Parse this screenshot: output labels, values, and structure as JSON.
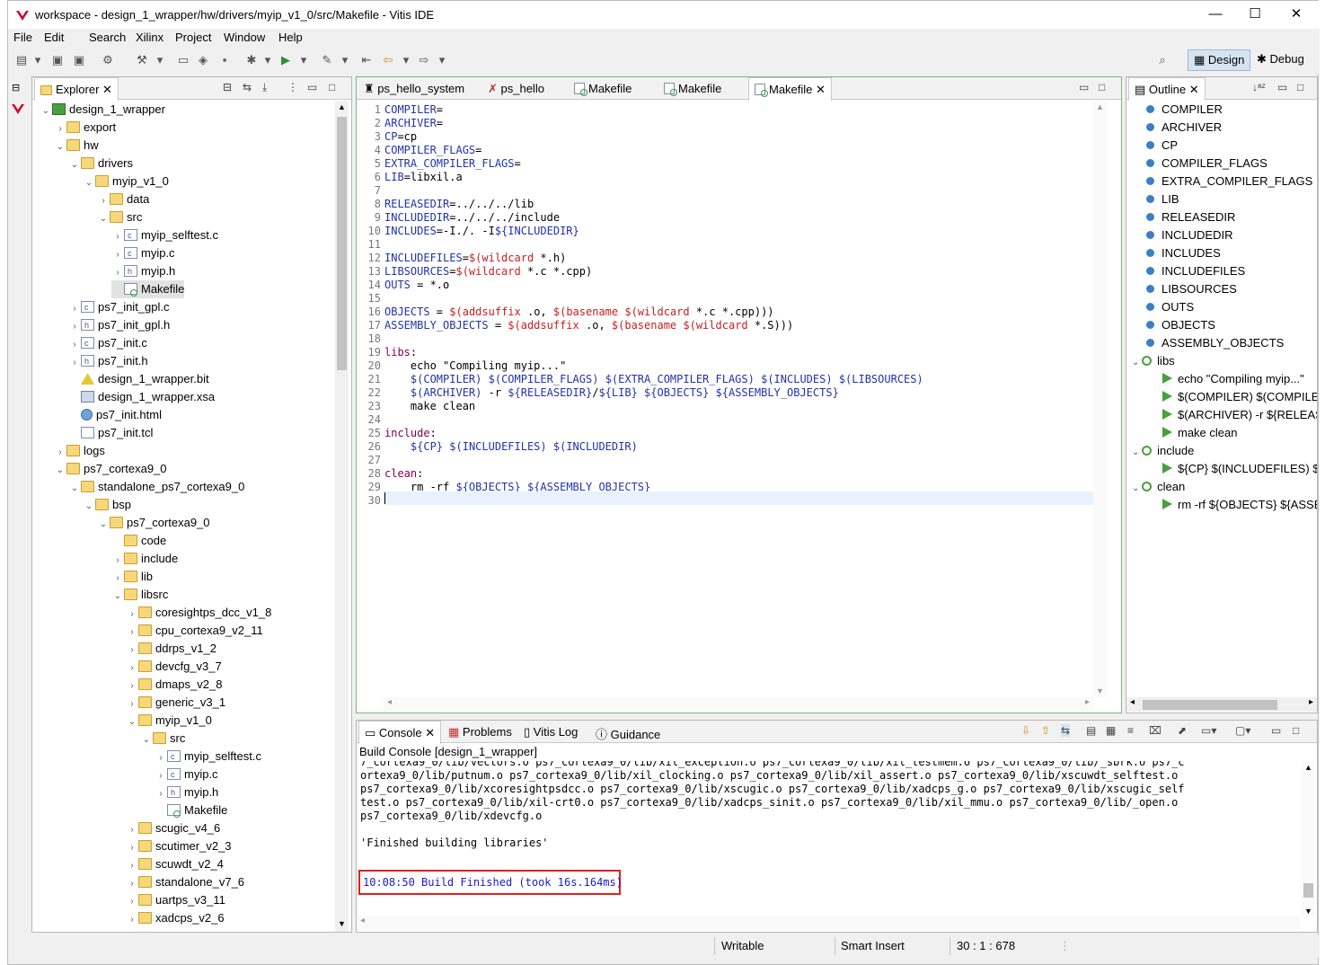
{
  "window": {
    "title": "workspace - design_1_wrapper/hw/drivers/myip_v1_0/src/Makefile - Vitis IDE",
    "minimize": "—",
    "maximize": "☐",
    "close": "✕"
  },
  "menu": [
    "File",
    "Edit",
    "Search",
    "Xilinx",
    "Project",
    "Window",
    "Help"
  ],
  "toolbar": {
    "design_label": "Design",
    "debug_label": "Debug"
  },
  "explorer": {
    "title": "Explorer",
    "items": [
      "design_1_wrapper",
      "export",
      "hw",
      "drivers",
      "myip_v1_0",
      "data",
      "src",
      "myip_selftest.c",
      "myip.c",
      "myip.h",
      "Makefile",
      "ps7_init_gpl.c",
      "ps7_init_gpl.h",
      "ps7_init.c",
      "ps7_init.h",
      "design_1_wrapper.bit",
      "design_1_wrapper.xsa",
      "ps7_init.html",
      "ps7_init.tcl",
      "logs",
      "ps7_cortexa9_0",
      "standalone_ps7_cortexa9_0",
      "bsp",
      "ps7_cortexa9_0",
      "code",
      "include",
      "lib",
      "libsrc",
      "coresightps_dcc_v1_8",
      "cpu_cortexa9_v2_11",
      "ddrps_v1_2",
      "devcfg_v3_7",
      "dmaps_v2_8",
      "generic_v3_1",
      "myip_v1_0",
      "src",
      "myip_selftest.c",
      "myip.c",
      "myip.h",
      "Makefile",
      "scugic_v4_6",
      "scutimer_v2_3",
      "scuwdt_v2_4",
      "standalone_v7_6",
      "uartps_v3_11",
      "xadcps_v2_6"
    ]
  },
  "editor": {
    "tabs": [
      "ps_hello_system",
      "ps_hello",
      "Makefile",
      "Makefile",
      "Makefile"
    ],
    "lines": [
      "COMPILER=",
      "ARCHIVER=",
      "CP=cp",
      "COMPILER_FLAGS=",
      "EXTRA_COMPILER_FLAGS=",
      "LIB=libxil.a",
      "",
      "RELEASEDIR=../../../lib",
      "INCLUDEDIR=../../../include",
      "INCLUDES=-I./. -I${INCLUDEDIR}",
      "",
      "INCLUDEFILES=$(wildcard *.h)",
      "LIBSOURCES=$(wildcard *.c *.cpp)",
      "OUTS = *.o",
      "",
      "OBJECTS = $(addsuffix .o, $(basename $(wildcard *.c *.cpp)))",
      "ASSEMBLY_OBJECTS = $(addsuffix .o, $(basename $(wildcard *.S)))",
      "",
      "libs:",
      "    echo \"Compiling myip...\"",
      "    $(COMPILER) $(COMPILER_FLAGS) $(EXTRA_COMPILER_FLAGS) $(INCLUDES) $(LIBSOURCES)",
      "    $(ARCHIVER) -r ${RELEASEDIR}/${LIB} ${OBJECTS} ${ASSEMBLY_OBJECTS}",
      "    make clean",
      "",
      "include:",
      "    ${CP} $(INCLUDEFILES) $(INCLUDEDIR)",
      "",
      "clean:",
      "    rm -rf ${OBJECTS} ${ASSEMBLY_OBJECTS}",
      ""
    ]
  },
  "outline": {
    "title": "Outline",
    "items": [
      "COMPILER",
      "ARCHIVER",
      "CP",
      "COMPILER_FLAGS",
      "EXTRA_COMPILER_FLAGS",
      "LIB",
      "RELEASEDIR",
      "INCLUDEDIR",
      "INCLUDES",
      "INCLUDEFILES",
      "LIBSOURCES",
      "OUTS",
      "OBJECTS",
      "ASSEMBLY_OBJECTS",
      "libs",
      "echo \"Compiling myip...\"",
      "$(COMPILER) $(COMPILEF",
      "$(ARCHIVER) -r ${RELEASE",
      "make clean",
      "include",
      "${CP} $(INCLUDEFILES) $(I",
      "clean",
      "rm -rf ${OBJECTS} ${ASSEI"
    ]
  },
  "console": {
    "tabs": [
      "Console",
      "Problems",
      "Vitis Log",
      "Guidance"
    ],
    "header": "Build Console [design_1_wrapper]",
    "lines": [
      "7_cortexa9_0/lib/vectors.o ps7_cortexa9_0/lib/xil_exception.o ps7_cortexa9_0/lib/xil_testmem.o ps7_cortexa9_0/lib/_sbrk.o ps7_c",
      "ortexa9_0/lib/putnum.o ps7_cortexa9_0/lib/xil_clocking.o ps7_cortexa9_0/lib/xil_assert.o ps7_cortexa9_0/lib/xscuwdt_selftest.o",
      "ps7_cortexa9_0/lib/xcoresightpsdcc.o ps7_cortexa9_0/lib/xscugic.o ps7_cortexa9_0/lib/xadcps_g.o ps7_cortexa9_0/lib/xscugic_self",
      "test.o ps7_cortexa9_0/lib/xil-crt0.o ps7_cortexa9_0/lib/xadcps_sinit.o ps7_cortexa9_0/lib/xil_mmu.o ps7_cortexa9_0/lib/_open.o",
      "ps7_cortexa9_0/lib/xdevcfg.o",
      "",
      "'Finished building libraries'"
    ],
    "finished": "10:08:50 Build Finished (took 16s.164ms)",
    "highlight_color": "#e02020"
  },
  "status": {
    "writable": "Writable",
    "insert": "Smart Insert",
    "position": "30 : 1 : 678"
  }
}
